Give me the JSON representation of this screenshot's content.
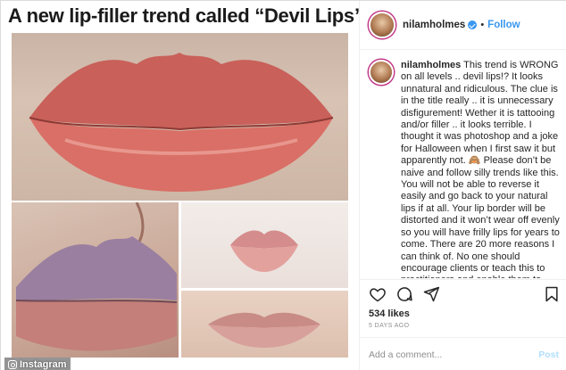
{
  "media": {
    "headline": "A new lip-filler trend called “Devil Lips”",
    "watermark": "Instagram",
    "watermark_icon": "instagram-camera-icon"
  },
  "header": {
    "username": "nilamholmes",
    "separator": "•",
    "follow_label": "Follow",
    "verified_icon": "verified-badge-icon"
  },
  "caption": {
    "username": "nilamholmes",
    "text": "This trend is WRONG on all levels .. devil lips!? It looks unnatural and ridiculous. The clue is in the title really .. it is unnecessary disfigurement! Wether it is tattooing and/or filler .. it looks terrible. I thought it was photoshop and a joke for Halloween when I first saw it but apparently not. 🙈 Please don’t be naive and follow silly trends like this. You will not be able to reverse it easily and go back to your natural lips if at all. Your lip border will be distorted and it won’t wear off evenly so you will have frilly lips for years to come. There are 20 more reasons I can think of. No one should encourage clients or teach this to practitioners and enable them to disfigure someone"
  },
  "actions": {
    "like_icon": "heart-icon",
    "comment_icon": "comment-icon",
    "share_icon": "share-icon",
    "save_icon": "bookmark-icon"
  },
  "likes": "534 likes",
  "date": "5 DAYS AGO",
  "comment_box": {
    "placeholder": "Add a comment...",
    "post_label": "Post"
  },
  "colors": {
    "accent": "#3897f0",
    "post_disabled": "#b2dffc",
    "muted": "#8e8e8e",
    "border": "#efefef"
  }
}
